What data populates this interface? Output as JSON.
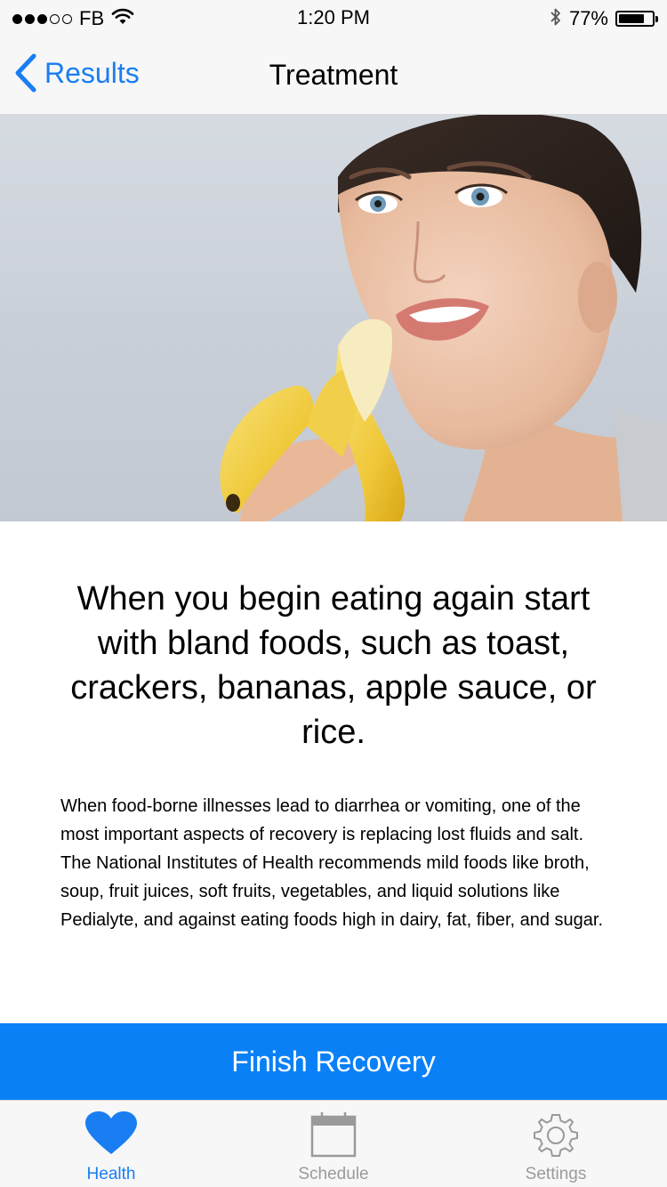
{
  "status_bar": {
    "carrier": "FB",
    "time": "1:20 PM",
    "battery_percent": "77%",
    "battery_level": 0.77,
    "signal_bars_filled": 3,
    "signal_bars_total": 5
  },
  "nav": {
    "back_label": "Results",
    "title": "Treatment"
  },
  "hero": {
    "icon": "banana-woman-photo"
  },
  "content": {
    "headline": "When you begin eating again start with bland foods, such as toast, crackers, bananas, apple sauce, or rice.",
    "body": "When food-borne illnesses lead to diarrhea or vomiting, one of the most important aspects of recovery is replacing lost fluids and salt. The National Institutes of Health recommends mild foods like broth, soup, fruit juices, soft fruits, vegetables, and liquid solutions like Pedialyte, and against eating foods high in dairy, fat, fiber, and sugar."
  },
  "finish_button": {
    "label": "Finish Recovery"
  },
  "tabs": [
    {
      "label": "Health",
      "icon": "heart-icon",
      "active": true
    },
    {
      "label": "Schedule",
      "icon": "calendar-icon",
      "active": false
    },
    {
      "label": "Settings",
      "icon": "gear-icon",
      "active": false
    }
  ],
  "colors": {
    "accent": "#1a7ef2",
    "button": "#0a80f7",
    "tab_inactive": "#9a9a9a"
  }
}
